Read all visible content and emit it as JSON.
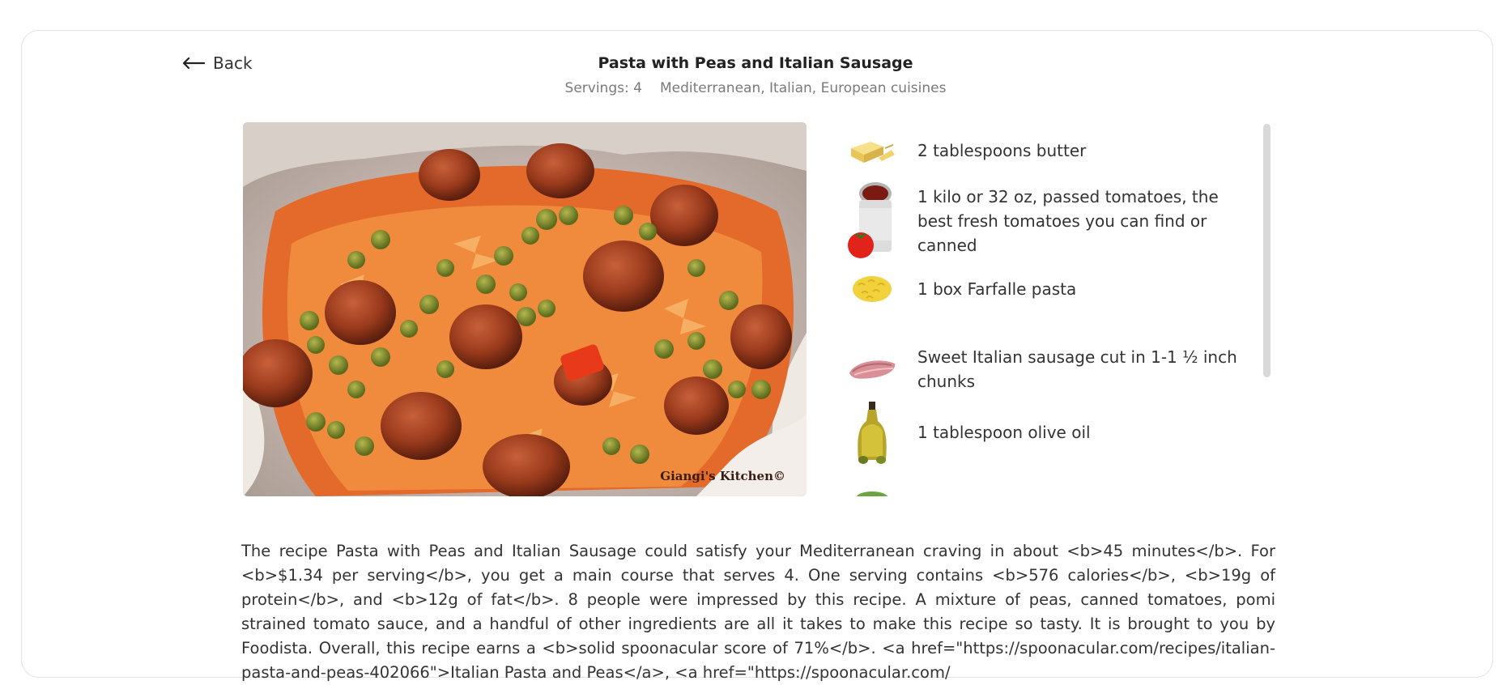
{
  "header": {
    "back_label": "Back",
    "title": "Pasta with Peas and Italian Sausage",
    "servings": "Servings: 4",
    "cuisines": "Mediterranean, Italian, European cuisines"
  },
  "photo": {
    "watermark": "Giangi's Kitchen©"
  },
  "ingredients": [
    {
      "label": "2 tablespoons butter",
      "icon": "butter-icon"
    },
    {
      "label": "1 kilo or 32 oz, passed tomatoes, the best fresh tomatoes you can find or canned",
      "icon": "tomato-can-icon"
    },
    {
      "label": "1 box Farfalle pasta",
      "icon": "pasta-icon"
    },
    {
      "label": "Sweet Italian sausage cut in 1-1 ½ inch chunks",
      "icon": "sausage-icon"
    },
    {
      "label": "1 tablespoon olive oil",
      "icon": "olive-oil-icon"
    }
  ],
  "description": "The recipe Pasta with Peas and Italian Sausage could satisfy your Mediterranean craving in about <b>45 minutes</b>. For <b>$1.34 per serving</b>, you get a main course that serves 4. One serving contains <b>576 calories</b>, <b>19g of protein</b>, and <b>12g of fat</b>. 8 people were impressed by this recipe. A mixture of peas, canned tomatoes, pomi strained tomato sauce, and a handful of other ingredients are all it takes to make this recipe so tasty. It is brought to you by Foodista. Overall, this recipe earns a <b>solid spoonacular score of 71%</b>. <a href=\"https://spoonacular.com/recipes/italian-pasta-and-peas-402066\">Italian Pasta and Peas</a>, <a href=\"https://spoonacular.com/"
}
